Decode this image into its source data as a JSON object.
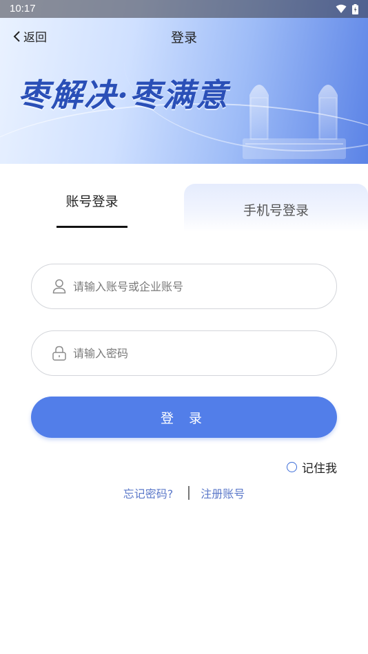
{
  "status_bar": {
    "time": "10:17"
  },
  "nav": {
    "back_label": "返回",
    "title": "登录"
  },
  "banner": {
    "slogan": "枣解决·枣满意"
  },
  "tabs": [
    {
      "label": "账号登录",
      "active": true
    },
    {
      "label": "手机号登录",
      "active": false
    }
  ],
  "form": {
    "account_placeholder": "请输入账号或企业账号",
    "password_placeholder": "请输入密码",
    "login_label": "登 录",
    "remember_label": "记住我"
  },
  "links": {
    "forgot": "忘记密码?",
    "register": "注册账号"
  },
  "colors": {
    "primary": "#527ee9",
    "link": "#5b78c9",
    "slogan": "#2a4fb7"
  },
  "icons": [
    "wifi-icon",
    "battery-icon",
    "chevron-left-icon",
    "user-icon",
    "lock-icon",
    "radio-unchecked-icon"
  ]
}
